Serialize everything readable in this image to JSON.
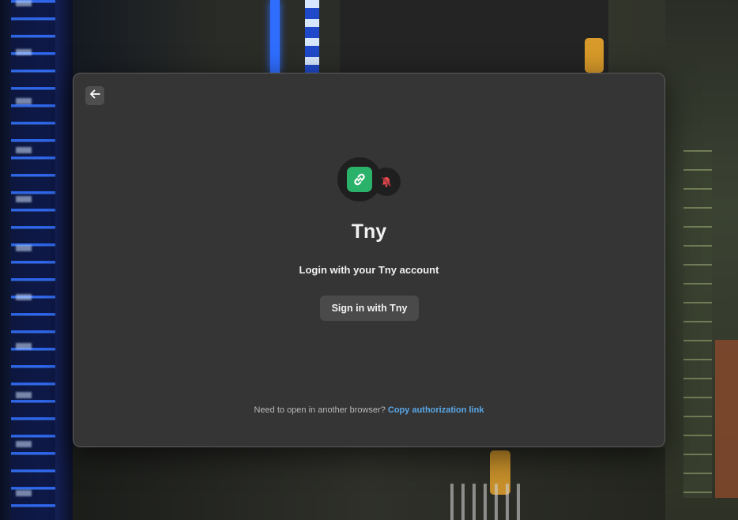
{
  "app": {
    "title": "Tny",
    "subtitle": "Login with your Tny account",
    "signin_label": "Sign in with Tny",
    "footer_prompt": "Need to open in another browser?",
    "footer_link": "Copy authorization link"
  },
  "icons": {
    "back": "arrow-left-icon",
    "logo": "link-icon",
    "badge": "bell-mute-icon"
  },
  "colors": {
    "accent": "#2bb26a",
    "badge": "#e0474c",
    "link": "#5aa7e6"
  }
}
